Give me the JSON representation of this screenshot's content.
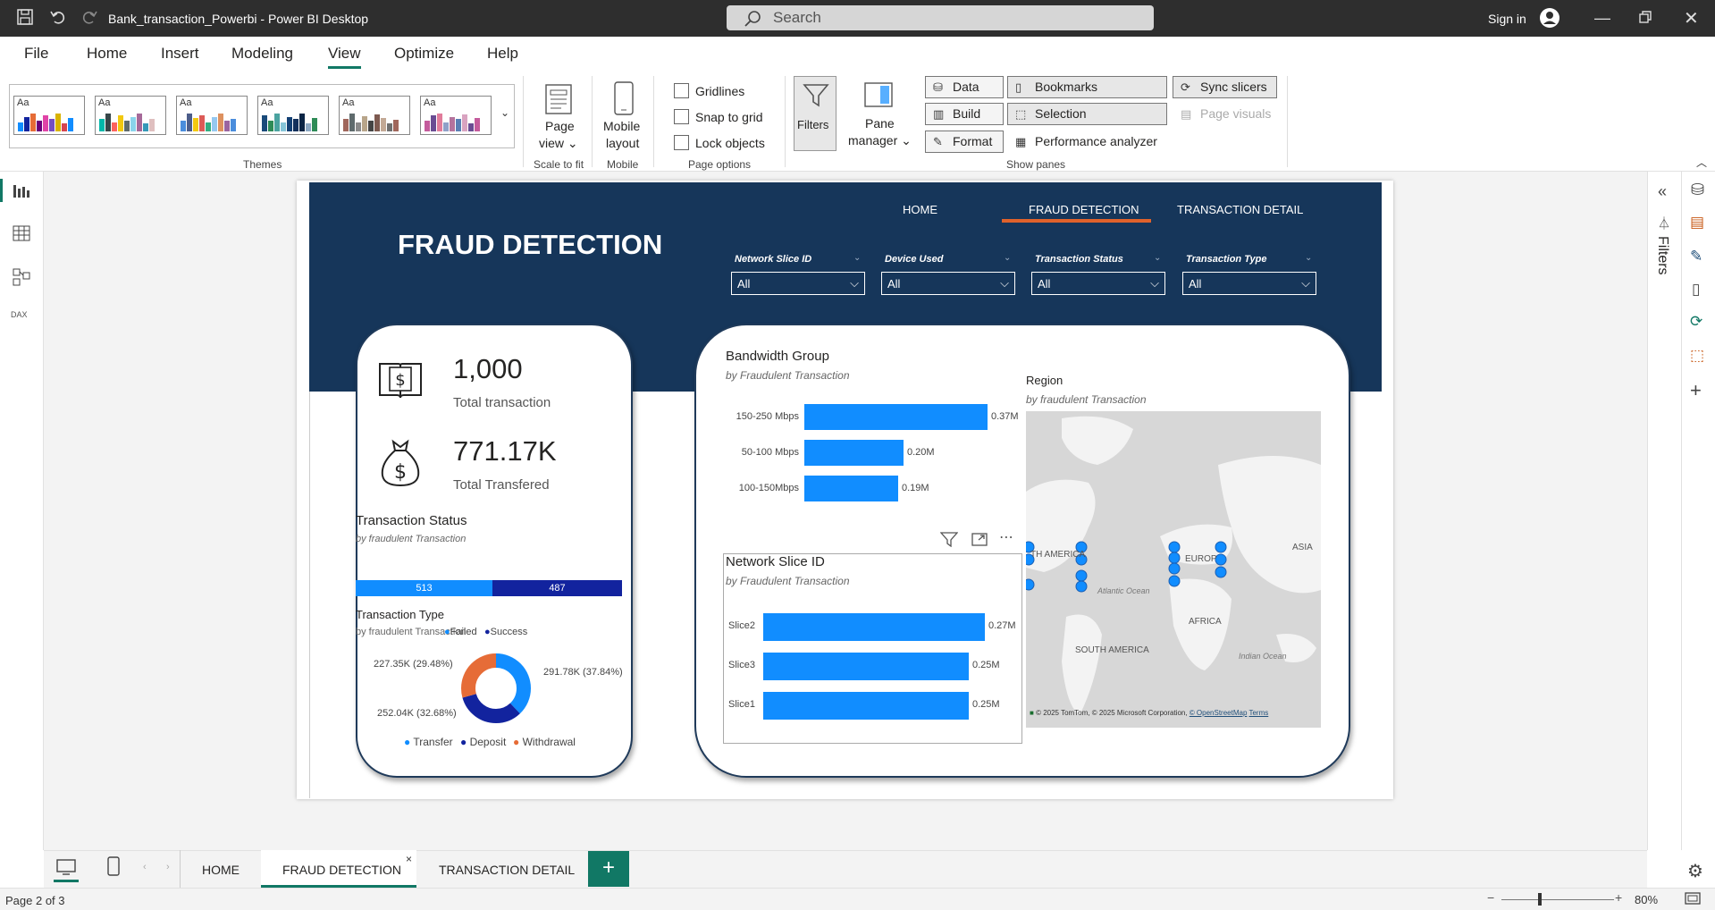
{
  "app": {
    "title": "Bank_transaction_Powerbi - Power BI Desktop",
    "search_placeholder": "Search",
    "sign_in": "Sign in"
  },
  "menu": [
    "File",
    "Home",
    "Insert",
    "Modeling",
    "View",
    "Optimize",
    "Help"
  ],
  "ribbon": {
    "themes_label": "Themes",
    "theme_aa": "Aa",
    "page_view": [
      "Page",
      "view"
    ],
    "scale_to_fit": "Scale to fit",
    "mobile_layout": [
      "Mobile",
      "layout"
    ],
    "mobile": "Mobile",
    "gridlines": "Gridlines",
    "snap_to_grid": "Snap to grid",
    "lock_objects": "Lock objects",
    "page_options": "Page options",
    "filters": "Filters",
    "pane_manager": [
      "Pane",
      "manager"
    ],
    "data": "Data",
    "build": "Build",
    "format": "Format",
    "bookmarks": "Bookmarks",
    "selection": "Selection",
    "performance_analyzer": "Performance analyzer",
    "sync_slicers": "Sync slicers",
    "page_visuals": "Page visuals",
    "show_panes": "Show panes"
  },
  "report": {
    "nav": [
      "HOME",
      "FRAUD DETECTION",
      "TRANSACTION DETAIL"
    ],
    "title": "FRAUD DETECTION",
    "slicers": [
      {
        "label": "Network Slice ID",
        "value": "All"
      },
      {
        "label": "Device Used",
        "value": "All"
      },
      {
        "label": "Transaction Status",
        "value": "All"
      },
      {
        "label": "Transaction Type",
        "value": "All"
      }
    ],
    "kpis": [
      {
        "value": "1,000",
        "label": "Total transaction"
      },
      {
        "value": "771.17K",
        "label": "Total Transfered"
      }
    ],
    "status": {
      "title": "Transaction Status",
      "subtitle": "by fraudulent Transaction",
      "segments": [
        {
          "name": "Failed",
          "value": 513,
          "color": "#118dff"
        },
        {
          "name": "Success",
          "value": 487,
          "color": "#12239e"
        }
      ]
    },
    "type": {
      "title": "Transaction Type",
      "subtitle": "by fraudulent Transaction",
      "slices": [
        {
          "name": "Transfer",
          "value": 291.78,
          "label": "291.78K (37.84%)",
          "color": "#118dff"
        },
        {
          "name": "Deposit",
          "value": 252.04,
          "label": "252.04K (32.68%)",
          "color": "#12239e"
        },
        {
          "name": "Withdrawal",
          "value": 227.35,
          "label": "227.35K (29.48%)",
          "color": "#e66c37"
        }
      ]
    },
    "bandwidth": {
      "title": "Bandwidth Group",
      "subtitle": "by Fraudulent Transaction",
      "bars": [
        {
          "cat": "150-250 Mbps",
          "value": 0.37,
          "label": "0.37M"
        },
        {
          "cat": "50-100 Mbps",
          "value": 0.2,
          "label": "0.20M"
        },
        {
          "cat": "100-150Mbps",
          "value": 0.19,
          "label": "0.19M"
        }
      ]
    },
    "network": {
      "title": "Network Slice ID",
      "subtitle": "by Fraudulent Transaction",
      "bars": [
        {
          "cat": "Slice2",
          "value": 0.27,
          "label": "0.27M"
        },
        {
          "cat": "Slice3",
          "value": 0.25,
          "label": "0.25M"
        },
        {
          "cat": "Slice1",
          "value": 0.25,
          "label": "0.25M"
        }
      ]
    },
    "region": {
      "title": "Region",
      "subtitle": "by fraudulent Transaction",
      "labels": {
        "na": "TH AMERICA",
        "europe": "EUROP",
        "asia": "ASIA",
        "atlantic": "Atlantic Ocean",
        "africa": "AFRICA",
        "sa": "SOUTH AMERICA",
        "indian": "Indian Ocean"
      },
      "attribution": "© 2025 TomTom, © 2025 Microsoft Corporation,",
      "osm": "© OpenStreetMap",
      "terms": "Terms"
    }
  },
  "tabs": [
    "HOME",
    "FRAUD DETECTION",
    "TRANSACTION DETAIL"
  ],
  "tab_close": "×",
  "status": {
    "page": "Page 2 of 3",
    "zoom": "80%"
  },
  "filters_pane": "Filters"
}
